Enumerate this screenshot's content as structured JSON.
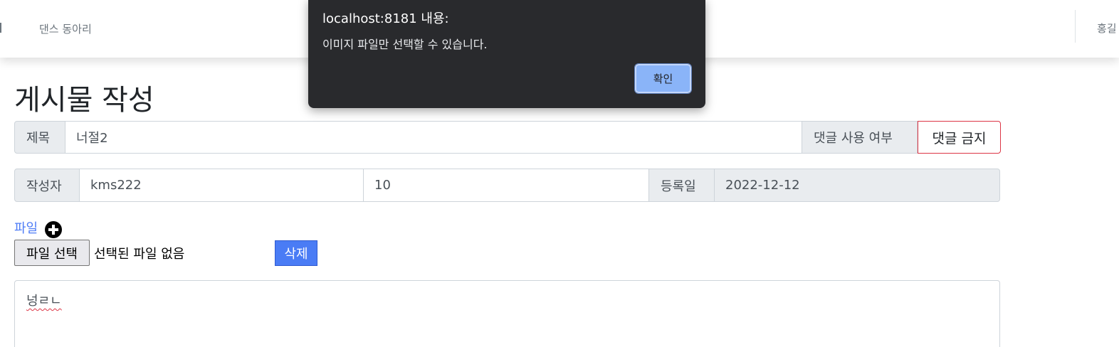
{
  "navbar": {
    "link": "댄스 동아리",
    "user": "홍길"
  },
  "page": {
    "title": "게시물 작성"
  },
  "title_row": {
    "label": "제목",
    "value": "너절2",
    "comment_label": "댓글 사용 여부",
    "comment_button": "댓글 금지"
  },
  "author_row": {
    "label": "작성자",
    "author": "kms222",
    "number": "10",
    "date_label": "등록일",
    "date": "2022-12-12"
  },
  "file": {
    "label": "파일",
    "add_icon": "plus-circle-icon",
    "choose_button": "파일 선택",
    "no_file_text": "선택된 파일 없음",
    "delete_button": "삭제"
  },
  "content": {
    "text": "넝ㄹㄴ"
  },
  "dialog": {
    "title": "localhost:8181 내용:",
    "message": "이미지 파일만 선택할 수 있습니다.",
    "ok_button": "확인"
  },
  "colors": {
    "accent": "#4a7cf5",
    "danger": "#dc3545",
    "dialog_bg": "#292a2d",
    "dialog_button": "#8ab4f8"
  }
}
